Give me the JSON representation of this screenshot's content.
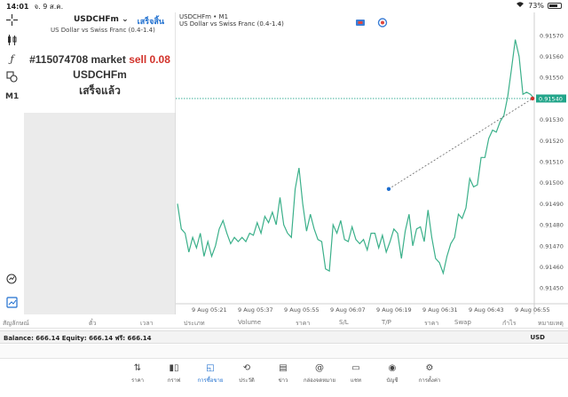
{
  "status_bar": {
    "time": "14:01",
    "date": "จ. 9 ส.ค.",
    "battery": "73%",
    "battery_level": 0.73
  },
  "toolbar": {
    "crosshair_icon": "crosshair-icon",
    "indicators_icon": "candles-icon",
    "function_icon": "function-icon",
    "objects_icon": "shapes-icon",
    "timeframe": "M1",
    "search_icon": "search-icon",
    "new_order_icon": "add-order-icon"
  },
  "order_panel": {
    "symbol": "USDCHFm",
    "done_label": "เสร็จสิ้น",
    "description": "US Dollar vs Swiss Franc (0.4-1.4)",
    "order_prefix": "#115074708 market",
    "order_type": "sell 0.08",
    "order_symbol": "USDCHFm",
    "order_status": "เสร็จแล้ว"
  },
  "chart_header": {
    "title": "USDCHFm • M1",
    "subtitle": "US Dollar vs Swiss Franc (0.4-1.4)"
  },
  "chart_data": {
    "type": "line",
    "title": "USDCHFm • M1",
    "x_ticks": [
      "9 Aug 05:21",
      "9 Aug 05:37",
      "9 Aug 05:55",
      "9 Aug 06:07",
      "9 Aug 06:19",
      "9 Aug 06:31",
      "9 Aug 06:43",
      "9 Aug 06:55"
    ],
    "y_ticks": [
      "0.91570",
      "0.91560",
      "0.91550",
      "0.91540",
      "0.91530",
      "0.91520",
      "0.91510",
      "0.91500",
      "0.91490",
      "0.91480",
      "0.91470",
      "0.91460",
      "0.91450"
    ],
    "ylim": [
      0.91445,
      0.91575
    ],
    "current_price": "0.91540",
    "series": [
      {
        "values": [
          0.9149,
          0.91478,
          0.91476,
          0.91467,
          0.91474,
          0.91469,
          0.91476,
          0.91465,
          0.91472,
          0.91465,
          0.9147,
          0.91478,
          0.91482,
          0.91476,
          0.91471,
          0.91474,
          0.91472,
          0.91474,
          0.91472,
          0.91476,
          0.91475,
          0.91481,
          0.91476,
          0.91484,
          0.91481,
          0.91486,
          0.9148,
          0.91493,
          0.9148,
          0.91476,
          0.91474,
          0.91497,
          0.91507,
          0.9149,
          0.91477,
          0.91485,
          0.91478,
          0.91473,
          0.91472,
          0.91459,
          0.91458,
          0.9148,
          0.91476,
          0.91482,
          0.91473,
          0.91472,
          0.91479,
          0.91473,
          0.91471,
          0.91473,
          0.91468,
          0.91476,
          0.91476,
          0.91469,
          0.91475,
          0.91467,
          0.91472,
          0.91478,
          0.91476,
          0.91464,
          0.91477,
          0.91485,
          0.9147,
          0.91478,
          0.91479,
          0.91472,
          0.91487,
          0.91474,
          0.91464,
          0.91462,
          0.91457,
          0.91465,
          0.91471,
          0.91474,
          0.91485,
          0.91483,
          0.91488,
          0.91502,
          0.91498,
          0.91499,
          0.91512,
          0.91512,
          0.91521,
          0.91525,
          0.91524,
          0.91529,
          0.91532,
          0.91541,
          0.91554,
          0.91568,
          0.9156,
          0.91542,
          0.91543,
          0.91542,
          0.9154
        ]
      }
    ],
    "trade_line": {
      "from": 0.91497,
      "to": 0.9154
    },
    "grid": false
  },
  "positions_columns": [
    "สัญลักษณ์",
    "ตั๋ว",
    "เวลา",
    "ประเภท",
    "Volume",
    "ราคา",
    "S/L",
    "T/P",
    "ราคา",
    "Swap",
    "กำไร",
    "หมายเหตุ"
  ],
  "balance_bar": {
    "text": "Balance: 666.14 Equity: 666.14 ฟรี: 666.14",
    "currency": "USD"
  },
  "tabs": [
    {
      "label": "ราคา",
      "icon": "updown-arrows-icon"
    },
    {
      "label": "กราฟ",
      "icon": "candles-icon"
    },
    {
      "label": "การซื้อขาย",
      "icon": "trade-chart-icon"
    },
    {
      "label": "ประวัติ",
      "icon": "history-icon"
    },
    {
      "label": "ข่าว",
      "icon": "news-icon"
    },
    {
      "label": "กล่องจดหมาย",
      "icon": "mailbox-icon"
    },
    {
      "label": "แชท",
      "icon": "chat-icon"
    },
    {
      "label": "บัญชี",
      "icon": "account-icon"
    },
    {
      "label": "การตั้งค่า",
      "icon": "settings-icon"
    }
  ],
  "colors": {
    "line": "#3bb08a",
    "price_marker": "#22a58a",
    "sell": "#d2332b",
    "accent": "#1f6fcf"
  }
}
